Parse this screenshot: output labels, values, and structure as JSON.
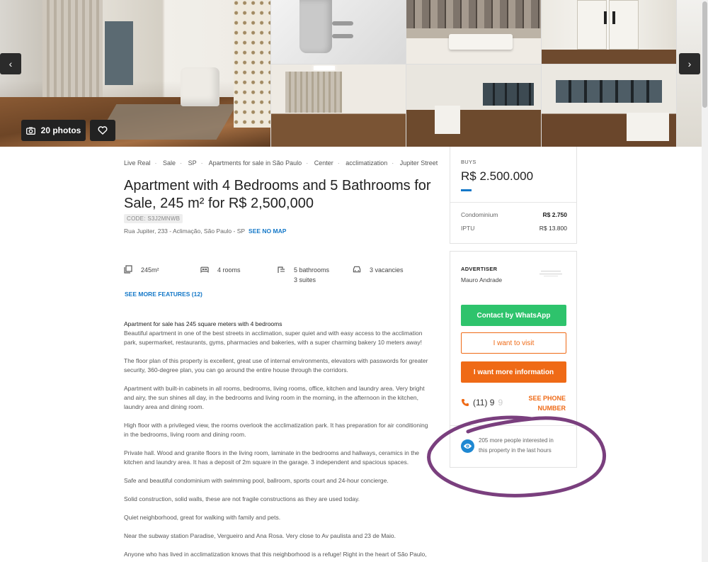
{
  "gallery": {
    "photos_label": "20 photos",
    "prev_icon": "‹",
    "next_icon": "›",
    "camera_icon": "camera-icon",
    "heart_icon": "heart-icon"
  },
  "breadcrumb": [
    "Live Real",
    "Sale",
    "SP",
    "Apartments for sale in São Paulo",
    "Center",
    "acclimatization",
    "Jupiter Street"
  ],
  "listing": {
    "title": "Apartment with 4 Bedrooms and 5 Bathrooms for Sale, 245 m² for R$ 2,500,000",
    "code": "CODE: S3J2MNWB",
    "address": "Rua Jupiter, 233 - Aclimação, São Paulo - SP",
    "see_map": "SEE NO MAP"
  },
  "features": {
    "area": "245m²",
    "rooms": "4 rooms",
    "bathrooms": "5 bathrooms",
    "suites": "3 suites",
    "vacancies": "3 vacancies",
    "see_more": "SEE MORE FEATURES (12)"
  },
  "description": {
    "lead": "Apartment for sale has 245 square meters with 4 bedrooms",
    "p1": "Beautiful apartment in one of the best streets in acclimation, super quiet and with easy access to the acclimation park, supermarket, restaurants, gyms, pharmacies and bakeries, with a super charming bakery 10 meters away!",
    "p2": "The floor plan of this property is excellent, great use of internal environments, elevators with passwords for greater security, 360-degree plan, you can go around the entire house through the corridors.",
    "p3": "Apartment with built-in cabinets in all rooms, bedrooms, living rooms, office, kitchen and laundry area. Very bright and airy, the sun shines all day, in the bedrooms and living room in the morning, in the afternoon in the kitchen, laundry area and dining room.",
    "p4": "High floor with a privileged view, the rooms overlook the acclimatization park. It has preparation for air conditioning in the bedrooms, living room and dining room.",
    "p5": "Private hall. Wood and granite floors in the living room, laminate in the bedrooms and hallways, ceramics in the kitchen and laundry area. It has a deposit of 2m square in the garage. 3 independent and spacious spaces.",
    "p6": "Safe and beautiful condominium with swimming pool, ballroom, sports court and 24-hour concierge.",
    "p7": "Solid construction, solid walls, these are not fragile constructions as they are used today.",
    "p8": "Quiet neighborhood, great for walking with family and pets.",
    "p9": "Near the subway station Paradise, Vergueiro and Ana Rosa. Very close to Av paulista and 23 de Maio.",
    "p10": "Anyone who has lived in acclimatization knows that this neighborhood is a refuge! Right in the heart of São Paulo,"
  },
  "price": {
    "label": "BUYS",
    "value": "R$ 2.500.000",
    "condo_label": "Condominium",
    "condo_value": "R$ 2.750",
    "iptu_label": "IPTU",
    "iptu_value": "R$ 13.800"
  },
  "advertiser": {
    "label": "ADVERTISER",
    "name": "Mauro Andrade",
    "whatsapp": "Contact by WhatsApp",
    "visit": "I want to visit",
    "info": "I want more information",
    "phone_partial": "(11) 9",
    "phone_fade": "9",
    "see_phone": "SEE PHONE NUMBER",
    "interest": "205 more people interested in this property in the last hours"
  },
  "colors": {
    "accent_blue": "#1478c8",
    "whatsapp_green": "#2ec36c",
    "orange": "#ef6a16",
    "annotation_purple": "#7a3f7e"
  }
}
